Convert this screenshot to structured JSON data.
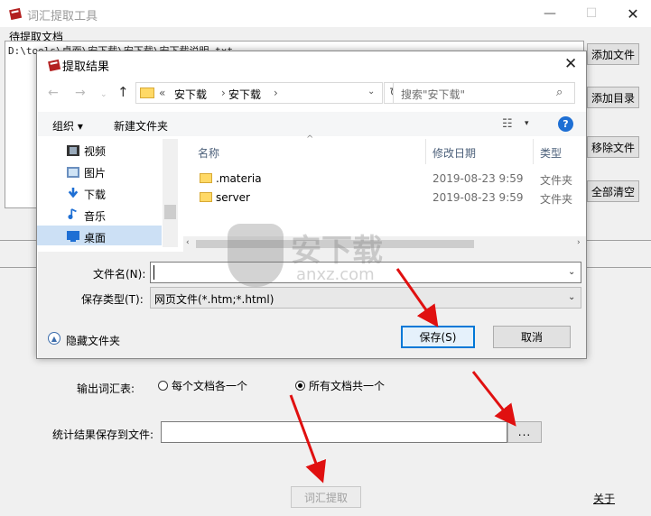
{
  "window": {
    "title": "词汇提取工具",
    "min": "—",
    "max": "☐",
    "close": "✕"
  },
  "docs": {
    "label": "待提取文档",
    "item": "D:\\tools\\桌面\\安下载\\安下载\\安下载说明.txt",
    "buttons": [
      "添加文件",
      "添加目录",
      "移除文件",
      "全部清空"
    ]
  },
  "output": {
    "label": "输出词汇表:",
    "option_each": "每个文档各一个",
    "option_all": "所有文档共一个",
    "selected": "all"
  },
  "save": {
    "label": "统计结果保存到文件:",
    "value": "",
    "browse": "..."
  },
  "extract_button": "词汇提取",
  "about_link": "关于",
  "dialog": {
    "title": "提取结果",
    "close": "✕",
    "nav": {
      "back": "←",
      "forward": "→",
      "recent": "⌄",
      "up": "↑"
    },
    "address": {
      "prefix": "«",
      "segments": [
        "安下载",
        "安下载"
      ],
      "sep": "›",
      "dropdown": "⌄",
      "refresh": "↻"
    },
    "search_placeholder": "搜索\"安下载\"",
    "search_icon": "⌕",
    "toolbar": {
      "organize": "组织 ▾",
      "new_folder": "新建文件夹",
      "view": "☷",
      "view_dd": "▾",
      "help": "?"
    },
    "tree": [
      {
        "label": "视频",
        "icon": "video-icon"
      },
      {
        "label": "图片",
        "icon": "picture-icon"
      },
      {
        "label": "下载",
        "icon": "download-icon"
      },
      {
        "label": "音乐",
        "icon": "music-icon"
      },
      {
        "label": "桌面",
        "icon": "desktop-icon",
        "selected": true
      }
    ],
    "columns": {
      "name": "名称",
      "date": "修改日期",
      "type": "类型",
      "sort_caret": "^"
    },
    "files": [
      {
        "name": ".materia",
        "date": "2019-08-23 9:59",
        "type": "文件夹"
      },
      {
        "name": "server",
        "date": "2019-08-23 9:59",
        "type": "文件夹"
      }
    ],
    "scroll": {
      "left": "‹",
      "right": "›"
    },
    "filename_label": "文件名(N):",
    "filename_value": "",
    "filetype_label": "保存类型(T):",
    "filetype_value": "网页文件(*.htm;*.html)",
    "dropdown": "⌄",
    "hide_folders": "隐藏文件夹",
    "hide_caret": "▲",
    "save_button": "保存(S)",
    "cancel_button": "取消"
  },
  "watermark": {
    "text": "安下载",
    "sub": "anxz.com"
  },
  "colors": {
    "accent": "#0078d7",
    "arrow": "#e01010",
    "selection": "#cce0f5"
  }
}
